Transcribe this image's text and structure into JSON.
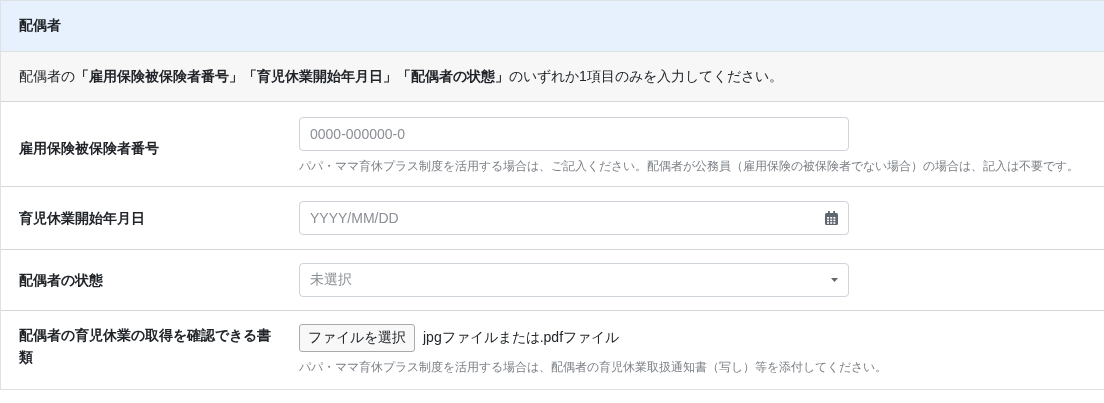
{
  "section": {
    "title": "配偶者"
  },
  "notice": "配偶者の**「雇用保険被保険者番号」「育児休業開始年月日」「配偶者の状態」**のいずれか1項目のみを入力してください。",
  "fields": [
    {
      "kind": "text",
      "label": "雇用保険被保険者番号",
      "placeholder": "0000-000000-0",
      "help": "パパ・ママ育休プラス制度を活用する場合は、ご記入ください。配偶者が公務員（雇用保険の被保険者でない場合）の場合は、記入は不要です。"
    },
    {
      "kind": "date",
      "label": "育児休業開始年月日",
      "placeholder": "YYYY/MM/DD"
    },
    {
      "kind": "select",
      "label": "配偶者の状態",
      "placeholder": "未選択"
    },
    {
      "kind": "file",
      "label": "配偶者の育児休業の取得を確認できる書類",
      "button": "ファイルを選択",
      "note": "jpgファイルまたは.pdfファイル",
      "help": "パパ・ママ育休プラス制度を活用する場合は、配偶者の育児休業取扱通知書（写し）等を添付してください。"
    }
  ]
}
